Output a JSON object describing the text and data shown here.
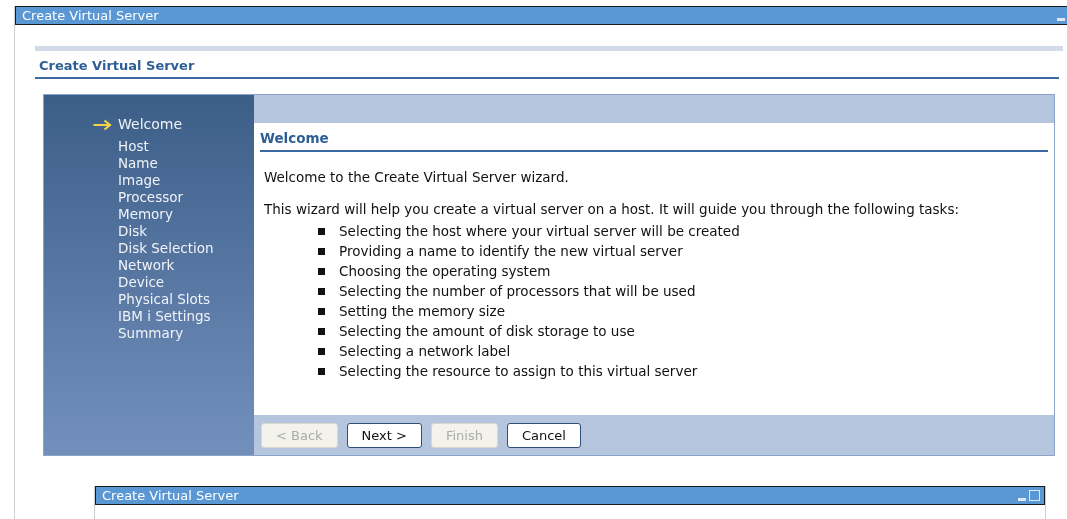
{
  "window": {
    "title": "Create Virtual Server"
  },
  "page_title": "Create Virtual Server",
  "steps": [
    {
      "label": "Welcome",
      "selected": true
    },
    {
      "label": "Host",
      "selected": false
    },
    {
      "label": "Name",
      "selected": false
    },
    {
      "label": "Image",
      "selected": false
    },
    {
      "label": "Processor",
      "selected": false
    },
    {
      "label": "Memory",
      "selected": false
    },
    {
      "label": "Disk",
      "selected": false
    },
    {
      "label": "Disk Selection",
      "selected": false
    },
    {
      "label": "Network",
      "selected": false
    },
    {
      "label": "Device",
      "selected": false
    },
    {
      "label": "Physical Slots",
      "selected": false
    },
    {
      "label": "IBM i Settings",
      "selected": false
    },
    {
      "label": "Summary",
      "selected": false
    }
  ],
  "section_title": "Welcome",
  "intro": "Welcome to the Create Virtual Server wizard.",
  "description": "This wizard will help you create a virtual server on a host. It will guide you through the following tasks:",
  "tasks": [
    "Selecting the host where your virtual server will be created",
    "Providing a name to identify the new virtual server",
    "Choosing the operating system",
    "Selecting the number of processors that will be used",
    "Setting the memory size",
    "Selecting the amount of disk storage to use",
    "Selecting a network label",
    "Selecting the resource to assign to this virtual server"
  ],
  "buttons": [
    {
      "label": "< Back",
      "disabled": true
    },
    {
      "label": "Next >",
      "disabled": false
    },
    {
      "label": "Finish",
      "disabled": true
    },
    {
      "label": "Cancel",
      "disabled": false
    }
  ],
  "second_window": {
    "title": "Create Virtual Server"
  }
}
